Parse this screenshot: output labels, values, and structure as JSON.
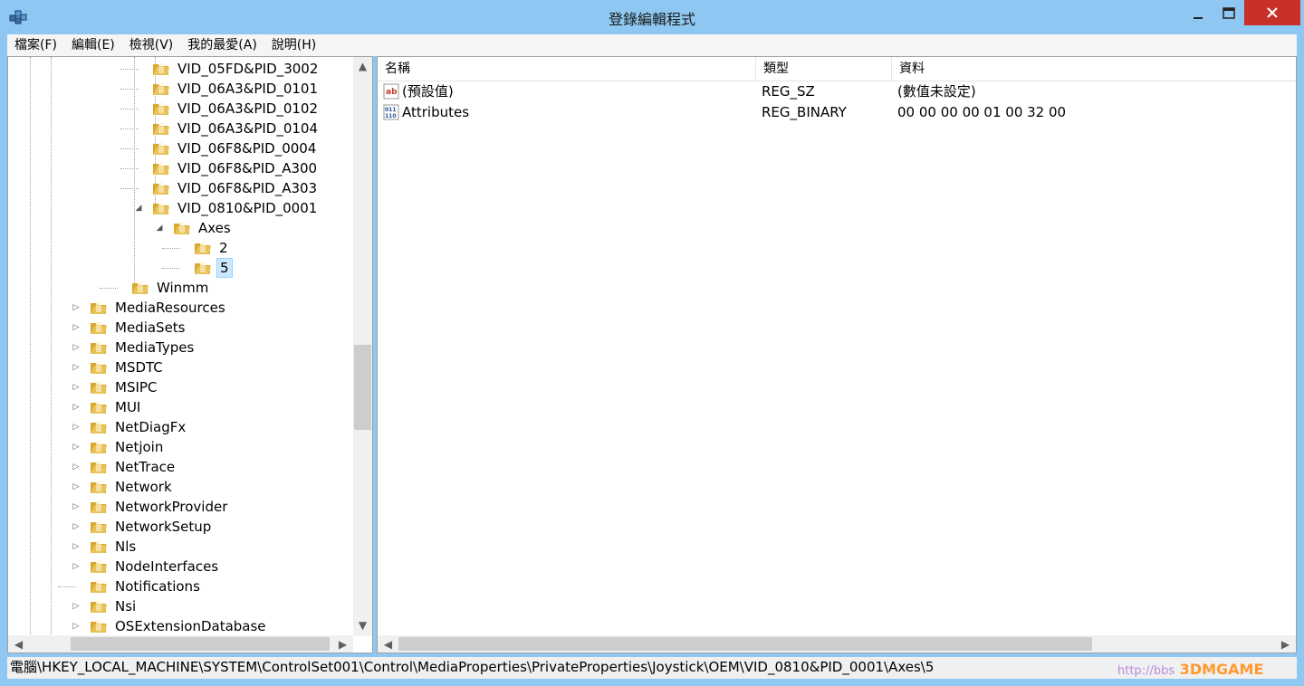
{
  "window": {
    "title": "登錄編輯程式",
    "controls": {
      "minimize_icon": "minimize-icon",
      "maximize_icon": "maximize-icon",
      "close_icon": "close-icon"
    }
  },
  "menu": [
    "檔案(F)",
    "編輯(E)",
    "檢視(V)",
    "我的最愛(A)",
    "說明(H)"
  ],
  "tree": {
    "items": [
      {
        "label": "VID_05FD&PID_3002",
        "expander": ""
      },
      {
        "label": "VID_06A3&PID_0101",
        "expander": ""
      },
      {
        "label": "VID_06A3&PID_0102",
        "expander": ""
      },
      {
        "label": "VID_06A3&PID_0104",
        "expander": ""
      },
      {
        "label": "VID_06F8&PID_0004",
        "expander": ""
      },
      {
        "label": "VID_06F8&PID_A300",
        "expander": ""
      },
      {
        "label": "VID_06F8&PID_A303",
        "expander": ""
      },
      {
        "label": "VID_0810&PID_0001",
        "expander": "◢"
      },
      {
        "label": "Axes",
        "expander": "◢"
      },
      {
        "label": "2",
        "expander": ""
      },
      {
        "label": "5",
        "expander": "",
        "selected": true
      },
      {
        "label": "Winmm",
        "expander": ""
      },
      {
        "label": "MediaResources",
        "expander": "▷"
      },
      {
        "label": "MediaSets",
        "expander": "▷"
      },
      {
        "label": "MediaTypes",
        "expander": "▷"
      },
      {
        "label": "MSDTC",
        "expander": "▷"
      },
      {
        "label": "MSIPC",
        "expander": "▷"
      },
      {
        "label": "MUI",
        "expander": "▷"
      },
      {
        "label": "NetDiagFx",
        "expander": "▷"
      },
      {
        "label": "Netjoin",
        "expander": "▷"
      },
      {
        "label": "NetTrace",
        "expander": "▷"
      },
      {
        "label": "Network",
        "expander": "▷"
      },
      {
        "label": "NetworkProvider",
        "expander": "▷"
      },
      {
        "label": "NetworkSetup",
        "expander": "▷"
      },
      {
        "label": "Nls",
        "expander": "▷"
      },
      {
        "label": "NodeInterfaces",
        "expander": "▷"
      },
      {
        "label": "Notifications",
        "expander": ""
      },
      {
        "label": "Nsi",
        "expander": "▷"
      },
      {
        "label": "OSExtensionDatabase",
        "expander": "▷"
      }
    ]
  },
  "list": {
    "columns": [
      "名稱",
      "類型",
      "資料"
    ],
    "rows": [
      {
        "name": "(預設值)",
        "type": "REG_SZ",
        "data": "(數值未設定)",
        "icon": "string-value-icon"
      },
      {
        "name": "Attributes",
        "type": "REG_BINARY",
        "data": "00 00 00 00 01 00 32 00",
        "icon": "binary-value-icon"
      }
    ]
  },
  "status": {
    "path": "電腦\\HKEY_LOCAL_MACHINE\\SYSTEM\\ControlSet001\\Control\\MediaProperties\\PrivateProperties\\Joystick\\OEM\\VID_0810&PID_0001\\Axes\\5"
  },
  "watermark": {
    "url": "http://bbs",
    "brand": "3DMGAME"
  },
  "colors": {
    "titlebar": "#8ec8f2",
    "close": "#c7312a",
    "selection": "#cce8ff",
    "folder": "#e8c35a"
  }
}
